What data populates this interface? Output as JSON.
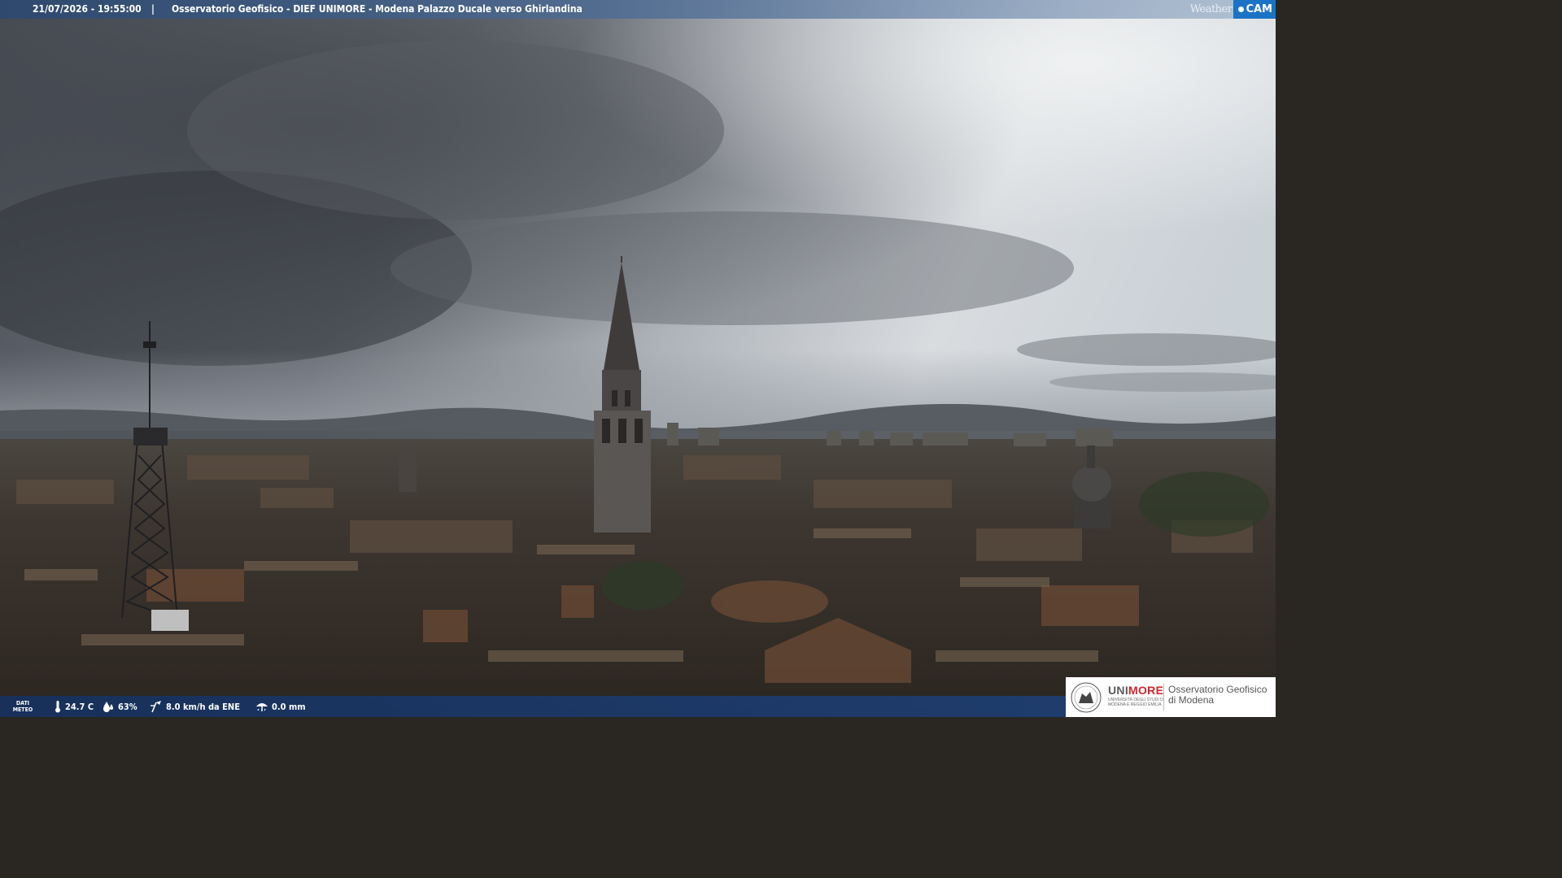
{
  "header": {
    "timestamp": "21/07/2026 - 19:55:00",
    "separator": "|",
    "title": "Osservatorio Geofisico - DIEF UNIMORE - Modena Palazzo Ducale verso Ghirlandina"
  },
  "brand": {
    "weather": "Weather",
    "cam": "CAM",
    "accent_color": "#1b73c6"
  },
  "footer": {
    "label_line1": "DATI",
    "label_line2": "METEO",
    "temperature": "24.7 C",
    "humidity": "63%",
    "wind": "8.0 km/h da ENE",
    "rain": "0.0 mm",
    "icons": [
      "thermometer-icon",
      "humidity-drop-icon",
      "wind-icon",
      "rain-icon"
    ]
  },
  "institution": {
    "name_uni": "UNI",
    "name_more": "MORE",
    "subtitle": "UNIVERSITÀ DEGLI STUDI DI MODENA E REGGIO EMILIA",
    "observatory_line1": "Osservatorio Geofisico",
    "observatory_line2": "di Modena",
    "brand_color": "#d0242b"
  }
}
